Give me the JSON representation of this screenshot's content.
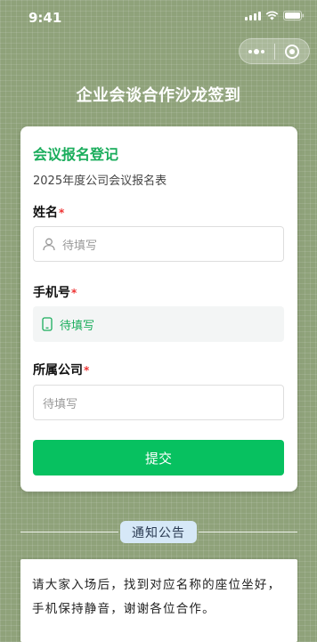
{
  "status_bar": {
    "time": "9:41",
    "signal_icon": "signal-icon",
    "wifi_icon": "wifi-icon",
    "battery_icon": "battery-icon"
  },
  "capsule": {
    "more_icon": "more-dots-icon",
    "close_icon": "target-circle-icon"
  },
  "page": {
    "title": "企业会谈合作沙龙签到"
  },
  "form": {
    "title": "会议报名登记",
    "subtitle": "2025年度公司会议报名表",
    "required_mark": "*",
    "fields": [
      {
        "label": "姓名",
        "placeholder": "待填写",
        "icon": "user-icon"
      },
      {
        "label": "手机号",
        "placeholder": "待填写",
        "icon": "phone-icon"
      },
      {
        "label": "所属公司",
        "placeholder": "待填写"
      }
    ],
    "submit_label": "提交"
  },
  "notice": {
    "badge": "通知公告",
    "text": "请大家入场后，找到对应名称的座位坐好，手机保持静音，谢谢各位合作。"
  },
  "colors": {
    "accent": "#07c160",
    "title_green": "#1aad5c",
    "background": "#8fa27a",
    "notice_badge": "#d6e8f7"
  }
}
